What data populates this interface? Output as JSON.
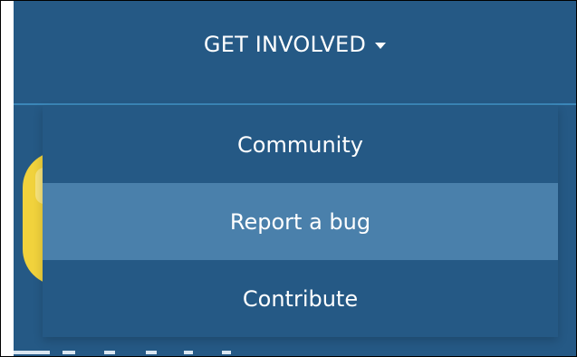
{
  "nav": {
    "dropdown_label": "GET INVOLVED",
    "caret_icon": "caret-down-icon"
  },
  "menu": {
    "items": [
      {
        "label": "Community",
        "active": false
      },
      {
        "label": "Report a bug",
        "active": true
      },
      {
        "label": "Contribute",
        "active": false
      }
    ]
  },
  "colors": {
    "nav_bg": "#255985",
    "hover_bg": "#4a80ab",
    "text": "#ffffff",
    "accent_line": "#3b86b8",
    "logo_yellow": "#f1d23c"
  }
}
